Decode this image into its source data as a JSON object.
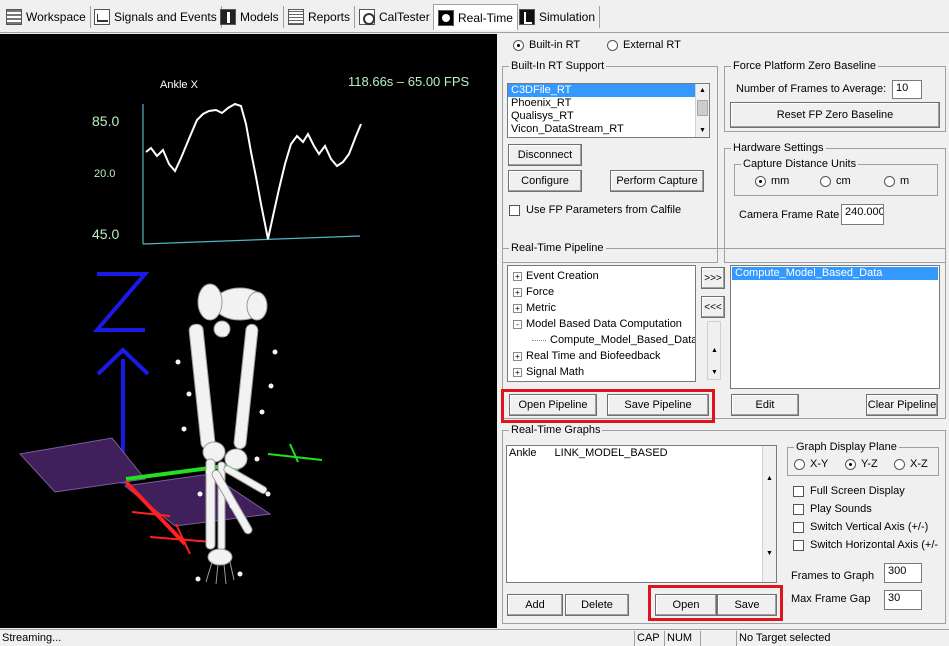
{
  "tabs": [
    {
      "label": "Workspace",
      "icon": "workspace-icon"
    },
    {
      "label": "Signals and Events",
      "icon": "signals-icon"
    },
    {
      "label": "Models",
      "icon": "models-icon"
    },
    {
      "label": "Reports",
      "icon": "reports-icon"
    },
    {
      "label": "CalTester",
      "icon": "caltester-icon"
    },
    {
      "label": "Real-Time",
      "icon": "realtime-icon",
      "active": true
    },
    {
      "label": "Simulation",
      "icon": "simulation-icon"
    }
  ],
  "viewport": {
    "graph_title": "Ankle  X",
    "time_fps": "118.66s  –  65.00  FPS",
    "y_labels": [
      "85.0",
      "20.0",
      "45.0"
    ],
    "axis_label": "Z",
    "colors": {
      "background": "#000000",
      "trace": "#ffffff",
      "axis_lines": "#4fb6c8",
      "labels": "#b8f0c0",
      "z_axis": "#1a1ae6",
      "x_axis": "#ff2020",
      "y_axis": "#20e020",
      "plate": "#40205a"
    }
  },
  "rt_mode": {
    "builtin_label": "Built-in RT",
    "external_label": "External RT",
    "selected": "builtin"
  },
  "builtin_support": {
    "legend": "Built-In RT Support",
    "items": [
      "C3DFile_RT",
      "Phoenix_RT",
      "Qualisys_RT",
      "Vicon_DataStream_RT"
    ],
    "selected_index": 0,
    "disconnect_label": "Disconnect",
    "configure_label": "Configure",
    "perform_capture_label": "Perform Capture",
    "use_fp_label": "Use FP Parameters from Calfile"
  },
  "force_platform": {
    "legend": "Force Platform Zero Baseline",
    "frames_label": "Number of Frames to Average:",
    "frames_value": "10",
    "reset_label": "Reset FP Zero Baseline"
  },
  "hardware": {
    "legend": "Hardware Settings",
    "units_legend": "Capture Distance Units",
    "units": [
      "mm",
      "cm",
      "m"
    ],
    "selected_unit": "mm",
    "frame_rate_label": "Camera Frame Rate",
    "frame_rate_value": "240.000"
  },
  "pipeline": {
    "legend": "Real-Time Pipeline",
    "tree": [
      {
        "label": "Event Creation",
        "expander": "+"
      },
      {
        "label": "Force",
        "expander": "+"
      },
      {
        "label": "Metric",
        "expander": "+"
      },
      {
        "label": "Model Based Data Computation",
        "expander": "-"
      },
      {
        "label": "Compute_Model_Based_Data",
        "expander": "",
        "child": true
      },
      {
        "label": "Real Time and Biofeedback",
        "expander": "+"
      },
      {
        "label": "Signal Math",
        "expander": "+"
      }
    ],
    "add_label": ">>>",
    "remove_label": "<<<",
    "selected_items": [
      "Compute_Model_Based_Data"
    ],
    "open_label": "Open Pipeline",
    "save_label": "Save Pipeline",
    "edit_label": "Edit",
    "clear_label": "Clear Pipeline"
  },
  "graphs": {
    "legend": "Real-Time Graphs",
    "list": [
      {
        "name": "Ankle",
        "type": "LINK_MODEL_BASED"
      }
    ],
    "add_label": "Add",
    "delete_label": "Delete",
    "open_label": "Open",
    "save_label": "Save",
    "plane_legend": "Graph Display Plane",
    "planes": [
      "X-Y",
      "Y-Z",
      "X-Z"
    ],
    "selected_plane": "Y-Z",
    "options": [
      "Full Screen Display",
      "Play Sounds",
      "Switch Vertical Axis (+/-)",
      "Switch Horizontal Axis (+/-"
    ],
    "frames_label": "Frames to Graph",
    "frames_value": "300",
    "gap_label": "Max Frame Gap",
    "gap_value": "30"
  },
  "status": {
    "main": "Streaming...",
    "cap": "CAP",
    "num": "NUM",
    "blank": "",
    "target": "No Target selected"
  },
  "highlight_color": "#e0141e"
}
